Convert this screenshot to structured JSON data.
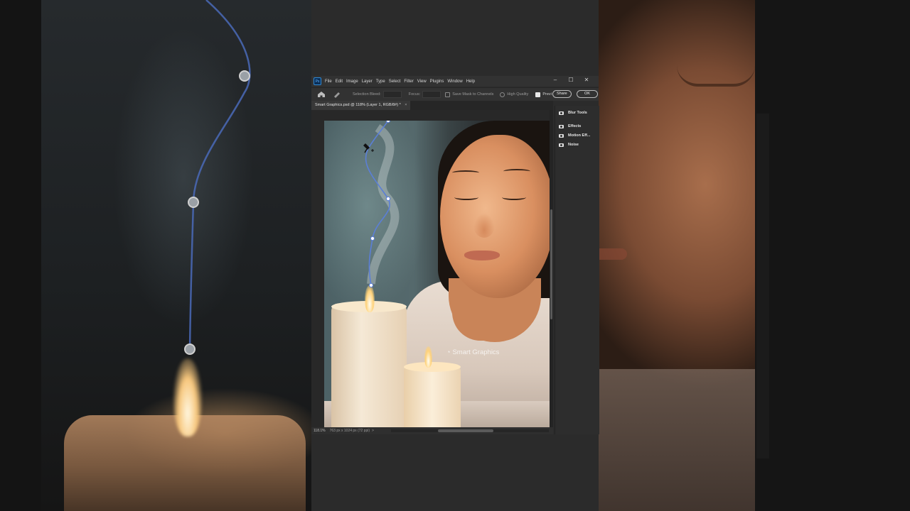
{
  "menubar": {
    "logo": "Ps",
    "items": [
      "File",
      "Edit",
      "Image",
      "Layer",
      "Type",
      "Select",
      "Filter",
      "View",
      "Plugins",
      "Window",
      "Help"
    ],
    "minimize": "–",
    "maximize": "☐",
    "close": "✕"
  },
  "options": {
    "selection_bleed_label": "Selection Bleed:",
    "focus_label": "Focus:",
    "save_mask_label": "Save Mask to Channels",
    "high_quality_label": "High Quality",
    "preview_label": "Previ",
    "share_label": "Share",
    "ok_label": "OK"
  },
  "document": {
    "tab_label": "Smart Graphics.psd @ 118% (Layer 1, RGB/8#) *",
    "tab_close": "×",
    "watermark": "Smart Graphics"
  },
  "status": {
    "zoom": "118.1%",
    "dimensions": "763 px x 1024 px (72 ppi)",
    "arrow": ">"
  },
  "panel": {
    "items": [
      "Blur Tools",
      "Effects",
      "Motion Eff...",
      "Noise"
    ]
  }
}
